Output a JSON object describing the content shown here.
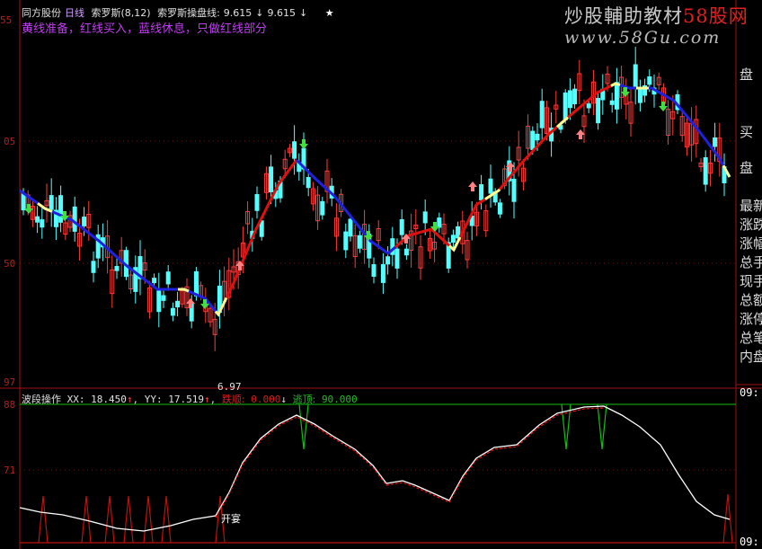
{
  "header": {
    "stock_name": "同方股份",
    "period": "日线",
    "indicator": "索罗斯(8,12)",
    "line_label": "索罗斯操盘线:",
    "value1": "9.615",
    "value1_arrow": "↓",
    "value2": "9.615",
    "value2_arrow": "↓",
    "stars": "★"
  },
  "legend": {
    "text": "黄线准备，红线买入，蓝线休息，只做红线部分"
  },
  "watermark": {
    "line1_a": "炒股輔助教材",
    "line1_b": "58股网",
    "line2": "www.58Gu.com"
  },
  "price_axis": {
    "label_top": "55",
    "label_mid1": "05",
    "label_mid2": "50",
    "label_low": "97"
  },
  "low_marker": "6.97",
  "sidebar": {
    "items": [
      "盘",
      "买",
      "盘",
      "最新",
      "涨跌",
      "涨幅",
      "总手",
      "现手",
      "总额",
      "涨停",
      "总笔",
      "内盘"
    ]
  },
  "lower_panel": {
    "title": "波段操作",
    "xx_label": "XX:",
    "xx_value": "18.450",
    "xx_arrow": "↑",
    "yy_label": "YY:",
    "yy_value": "17.519",
    "yy_arrow": "↑",
    "fall_label": "跌顺:",
    "fall_value": "0.000",
    "fall_arrow": "↓",
    "escape_label": "逃顶:",
    "escape_value": "90.000",
    "axis_top": "88",
    "axis_mid": "71",
    "open_label": "开宴",
    "time1": "09:",
    "time2": "09:"
  },
  "colors": {
    "up_candle": "#ff3b3b",
    "down_candle": "#54ffff",
    "blue_line": "#2020e0",
    "red_line": "#e01010",
    "yellow_line": "#ffff90",
    "green_line": "#10c010",
    "axis": "#a01010"
  }
}
